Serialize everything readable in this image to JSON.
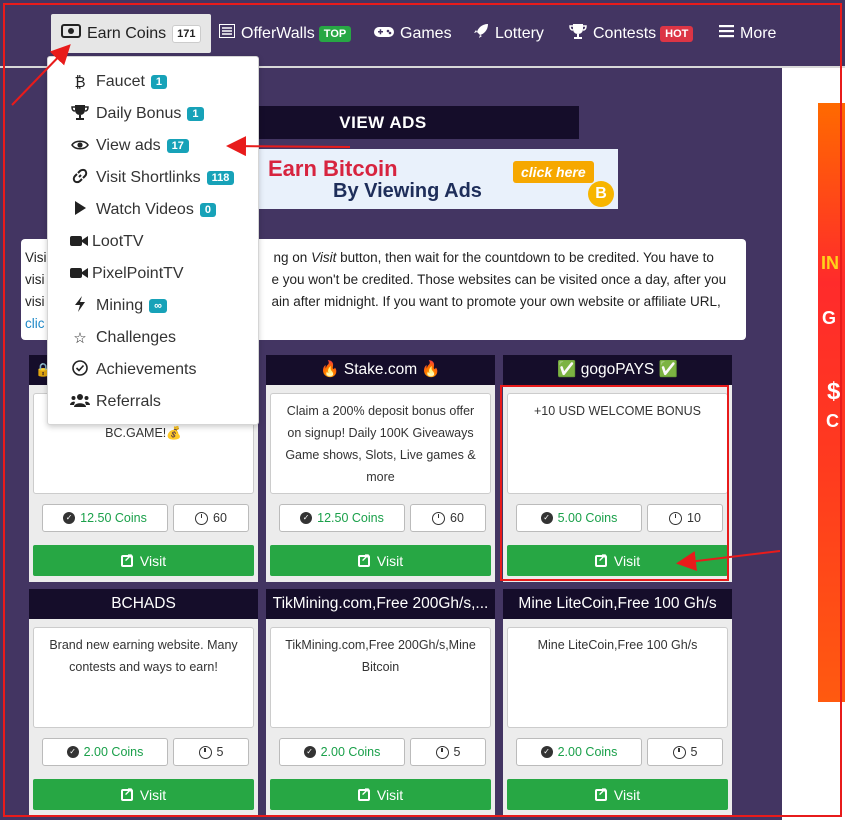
{
  "nav": {
    "earn_coins": {
      "label": "Earn Coins",
      "badge": "171"
    },
    "offerwalls": {
      "label": "OfferWalls",
      "badge": "TOP"
    },
    "games": {
      "label": "Games"
    },
    "lottery": {
      "label": "Lottery"
    },
    "contests": {
      "label": "Contests",
      "badge": "HOT"
    },
    "more": {
      "label": "More"
    }
  },
  "dropdown": {
    "items": [
      {
        "label": "Faucet",
        "badge": "1",
        "icon": "bitcoin-icon"
      },
      {
        "label": "Daily Bonus",
        "badge": "1",
        "icon": "trophy-icon"
      },
      {
        "label": "View ads",
        "badge": "17",
        "icon": "eye-icon"
      },
      {
        "label": "Visit Shortlinks",
        "badge": "118",
        "icon": "link-icon"
      },
      {
        "label": "Watch Videos",
        "badge": "0",
        "icon": "play-icon"
      },
      {
        "label": "LootTV",
        "icon": "video-camera-icon"
      },
      {
        "label": "PixelPointTV",
        "icon": "video-camera-icon"
      },
      {
        "label": "Mining",
        "badge": "∞",
        "icon": "bolt-icon"
      },
      {
        "label": "Challenges",
        "icon": "star-icon"
      },
      {
        "label": "Achievements",
        "icon": "check-circle-icon"
      },
      {
        "label": "Referrals",
        "icon": "users-icon"
      }
    ]
  },
  "page": {
    "title": "VIEW ADS",
    "banner": {
      "line1": "Earn Bitcoin",
      "line2": "By Viewing Ads",
      "button": "click here",
      "coin": "B"
    }
  },
  "intro": {
    "line1_a": "Visi",
    "line1_b": "ng on ",
    "line1_em": "Visit",
    "line1_c": " button, then wait for the countdown to be credited. You have to",
    "line2_a": "visi",
    "line2_b": "e you won't be credited. Those websites can be visited once a day, after you",
    "line3_a": "visi",
    "line3_b": "ain after midnight. If you want to promote your own website or affiliate URL,",
    "line4": "clic"
  },
  "ads": [
    {
      "title": "",
      "desc": "BC.GAME!💰",
      "coins": "12.50 Coins",
      "time": "60",
      "visit": "Visit"
    },
    {
      "title": "🔥 Stake.com 🔥",
      "desc": "Claim a 200% deposit bonus offer on signup! Daily 100K Giveaways Game shows, Slots, Live games & more",
      "coins": "12.50 Coins",
      "time": "60",
      "visit": "Visit"
    },
    {
      "title": "✅ gogoPAYS ✅",
      "desc": "+10 USD WELCOME BONUS",
      "coins": "5.00 Coins",
      "time": "10",
      "visit": "Visit"
    },
    {
      "title": "BCHADS",
      "desc": "Brand new earning website. Many contests and ways to earn!",
      "coins": "2.00 Coins",
      "time": "5",
      "visit": "Visit"
    },
    {
      "title": "TikMining.com,Free 200Gh/s,...",
      "desc": "TikMining.com,Free 200Gh/s,Mine Bitcoin",
      "coins": "2.00 Coins",
      "time": "5",
      "visit": "Visit"
    },
    {
      "title": "Mine LiteCoin,Free 100 Gh/s",
      "desc": "Mine LiteCoin,Free 100 Gh/s",
      "coins": "2.00 Coins",
      "time": "5",
      "visit": "Visit"
    }
  ],
  "side_ad": {
    "t1": "IN",
    "t2": "G",
    "t3": "$",
    "t4": "C"
  },
  "colors": {
    "nav_bg": "#433562",
    "card_header": "#150d2a",
    "visit_green": "#27a744",
    "annotation_red": "#e81b1b",
    "coin_green": "#1aa04a"
  }
}
